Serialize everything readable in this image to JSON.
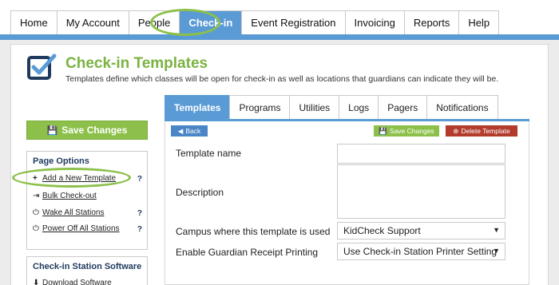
{
  "nav": {
    "tabs": [
      "Home",
      "My Account",
      "People",
      "Check-in",
      "Event Registration",
      "Invoicing",
      "Reports",
      "Help"
    ],
    "active": "Check-in"
  },
  "header": {
    "title": "Check-in Templates",
    "subtitle": "Templates define which classes will be open for check-in as well as locations that guardians can indicate they will be."
  },
  "sidebar": {
    "save_label": "Save Changes",
    "page_options": {
      "title": "Page Options",
      "items": [
        {
          "label": "Add a New Template",
          "icon": "plus-icon",
          "help": "?"
        },
        {
          "label": "Bulk Check-out",
          "icon": "logout-icon",
          "help": ""
        },
        {
          "label": "Wake All Stations",
          "icon": "power-icon",
          "help": "?"
        },
        {
          "label": "Power Off All Stations",
          "icon": "power-icon",
          "help": "?"
        }
      ]
    },
    "station_software": {
      "title": "Check-in Station Software",
      "download_label": "Download Software"
    }
  },
  "tabs": {
    "items": [
      "Templates",
      "Programs",
      "Utilities",
      "Logs",
      "Pagers",
      "Notifications"
    ],
    "active": "Templates"
  },
  "actions": {
    "back": "Back",
    "save": "Save Changes",
    "delete": "Delete Template"
  },
  "form": {
    "name_label": "Template name",
    "name_value": "",
    "description_label": "Description",
    "description_value": "",
    "campus_label": "Campus where this template is used",
    "campus_value": "KidCheck Support",
    "receipt_label": "Enable Guardian Receipt Printing",
    "receipt_value": "Use Check-in Station Printer Setting"
  },
  "colors": {
    "accent_blue": "#5b9bd5",
    "accent_green": "#8cc04a",
    "delete_red": "#b33b2b",
    "title_green": "#7ab342"
  }
}
